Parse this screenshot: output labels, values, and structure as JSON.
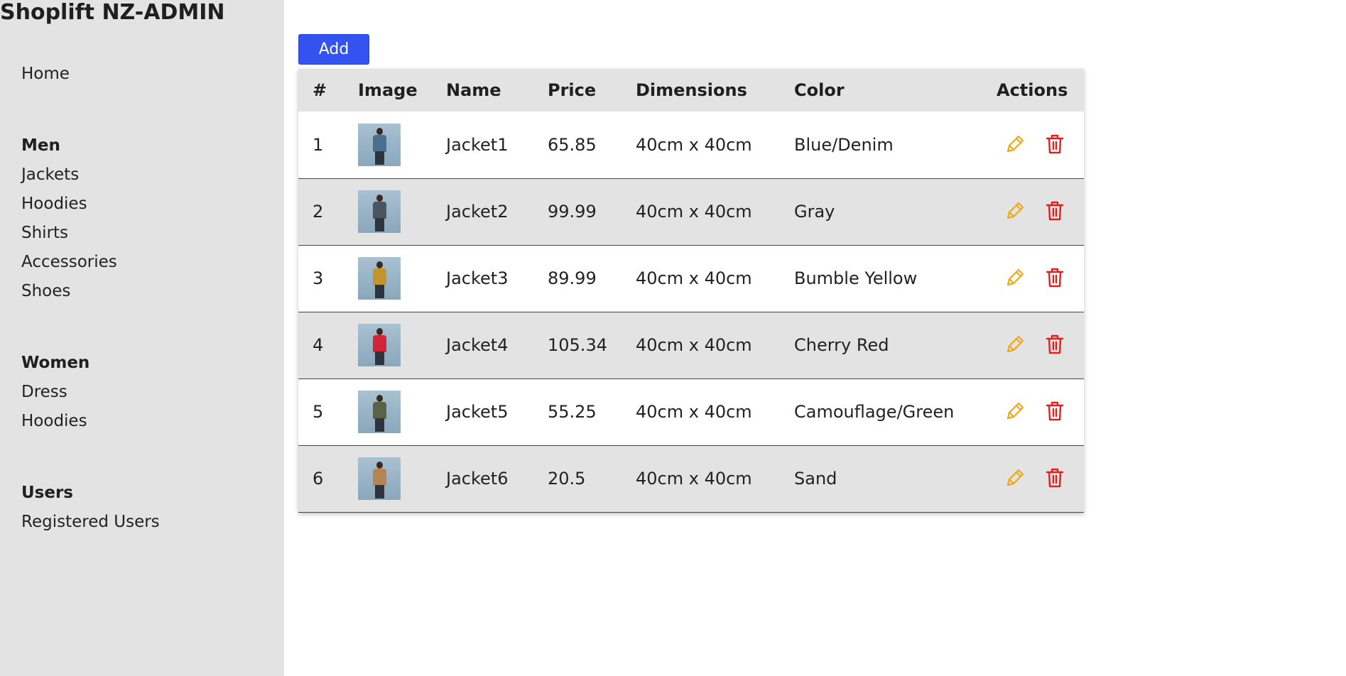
{
  "brand": "Shoplift NZ-ADMIN",
  "sidebar": {
    "home": "Home",
    "sections": [
      {
        "heading": "Men",
        "links": [
          "Jackets",
          "Hoodies",
          "Shirts",
          "Accessories",
          "Shoes"
        ]
      },
      {
        "heading": "Women",
        "links": [
          "Dress",
          "Hoodies"
        ]
      },
      {
        "heading": "Users",
        "links": [
          "Registered Users"
        ]
      }
    ]
  },
  "toolbar": {
    "add_label": "Add"
  },
  "table": {
    "headers": [
      "#",
      "Image",
      "Name",
      "Price",
      "Dimensions",
      "Color",
      "Actions"
    ],
    "rows": [
      {
        "id": "1",
        "name": "Jacket1",
        "price": "65.85",
        "dimensions": "40cm x 40cm",
        "color": "Blue/Denim",
        "jacket_color": "#4a6f8f"
      },
      {
        "id": "2",
        "name": "Jacket2",
        "price": "99.99",
        "dimensions": "40cm x 40cm",
        "color": "Gray",
        "jacket_color": "#4b5560"
      },
      {
        "id": "3",
        "name": "Jacket3",
        "price": "89.99",
        "dimensions": "40cm x 40cm",
        "color": "Bumble Yellow",
        "jacket_color": "#c4952f"
      },
      {
        "id": "4",
        "name": "Jacket4",
        "price": "105.34",
        "dimensions": "40cm x 40cm",
        "color": "Cherry Red",
        "jacket_color": "#d1243a"
      },
      {
        "id": "5",
        "name": "Jacket5",
        "price": "55.25",
        "dimensions": "40cm x 40cm",
        "color": "Camouflage/Green",
        "jacket_color": "#5a6248"
      },
      {
        "id": "6",
        "name": "Jacket6",
        "price": "20.5",
        "dimensions": "40cm x 40cm",
        "color": "Sand",
        "jacket_color": "#b48654"
      }
    ]
  },
  "icons": {
    "edit": "pencil-icon",
    "delete": "trash-icon"
  },
  "colors": {
    "accent": "#3452f0",
    "sidebar_bg": "#e3e3e3",
    "edit": "#f0a818",
    "delete": "#e0201c"
  }
}
